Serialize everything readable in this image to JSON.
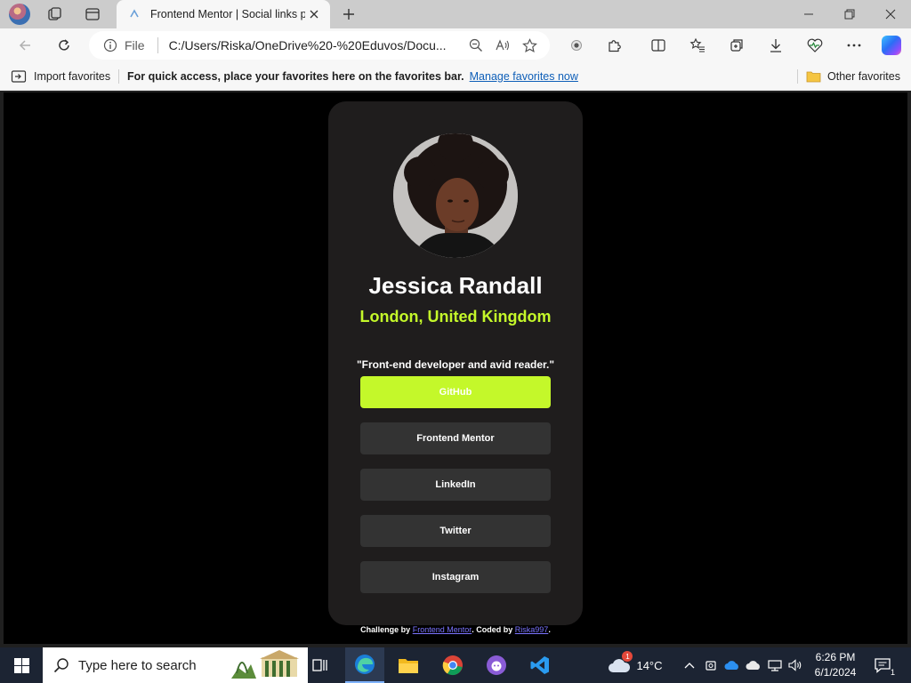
{
  "browser": {
    "tab": {
      "title": "Frontend Mentor | Social links pr"
    },
    "address": {
      "security_label": "File",
      "url": "C:/Users/Riska/OneDrive%20-%20Eduvos/Docu..."
    }
  },
  "favorites_bar": {
    "import_label": "Import favorites",
    "hint_text": "For quick access, place your favorites here on the favorites bar.",
    "manage_link": "Manage favorites now",
    "other_label": "Other favorites"
  },
  "profile": {
    "name": "Jessica Randall",
    "location": "London, United Kingdom",
    "bio": "\"Front-end developer and avid reader.\"",
    "links": [
      {
        "label": "GitHub"
      },
      {
        "label": "Frontend Mentor"
      },
      {
        "label": "LinkedIn"
      },
      {
        "label": "Twitter"
      },
      {
        "label": "Instagram"
      }
    ],
    "accent_color": "#c4f82a",
    "card_color": "#1f1d1d",
    "button_color": "#333333"
  },
  "attribution": {
    "prefix": "Challenge by",
    "challenge_link": "Frontend Mentor",
    "middle": ". Coded by",
    "author_link": "Riska997",
    "suffix": "."
  },
  "taskbar": {
    "search_placeholder": "Type here to search",
    "weather_temp": "14°C",
    "weather_badge": "1",
    "time": "6:26 PM",
    "date": "6/1/2024",
    "notification_count": "1"
  }
}
